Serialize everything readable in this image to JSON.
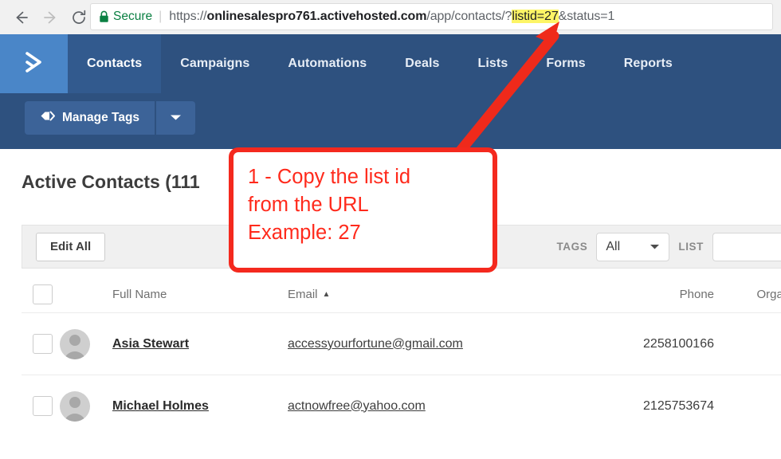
{
  "browser": {
    "back_icon": "back-arrow-icon",
    "forward_icon": "forward-arrow-icon",
    "reload_icon": "reload-icon",
    "lock_icon": "lock-icon",
    "secure_label": "Secure",
    "url": {
      "full": "https://onlinesalespro761.activehosted.com/app/contacts/?listid=27&status=1",
      "scheme": "https://",
      "host": "onlinesalespro761.activehosted.com",
      "path": "/app/contacts/?",
      "highlighted": "listid=27",
      "rest": "&status=1",
      "highlight_color": "#fdf566"
    }
  },
  "appnav": {
    "logo_icon": "activecampaign-chevron-logo",
    "logo_bg": "#4a86c8",
    "bar_bg": "#2e517f",
    "items": [
      {
        "label": "Contacts",
        "active": true
      },
      {
        "label": "Campaigns",
        "active": false
      },
      {
        "label": "Automations",
        "active": false
      },
      {
        "label": "Deals",
        "active": false
      },
      {
        "label": "Lists",
        "active": false
      },
      {
        "label": "Forms",
        "active": false
      },
      {
        "label": "Reports",
        "active": false
      }
    ]
  },
  "subbar": {
    "manage_tags_label": "Manage Tags",
    "tag_icon": "tag-icon",
    "caret_icon": "chevron-down-icon"
  },
  "page": {
    "title": "Active Contacts (111"
  },
  "toolbar": {
    "edit_all_label": "Edit All",
    "tags_label": "TAGS",
    "tags_value": "All",
    "list_label": "LIST",
    "list_value": ""
  },
  "table": {
    "columns": {
      "full_name": "Full Name",
      "email": "Email",
      "email_sort": "▲",
      "phone": "Phone",
      "organization": "Organiz"
    },
    "rows": [
      {
        "avatar": "avatar-placeholder-icon",
        "full_name": "Asia Stewart",
        "email": "accessyourfortune@gmail.com",
        "phone": "2258100166",
        "organization": "-"
      },
      {
        "avatar": "avatar-placeholder-icon",
        "full_name": "Michael Holmes",
        "email": "actnowfree@yahoo.com",
        "phone": "2125753674",
        "organization": "-"
      }
    ]
  },
  "annotation": {
    "color": "#ff2a1c",
    "line1": "1 - Copy the list id",
    "line2": "from the URL",
    "line3": "Example: 27",
    "arrow": "red-arrow-pointing-to-url"
  }
}
